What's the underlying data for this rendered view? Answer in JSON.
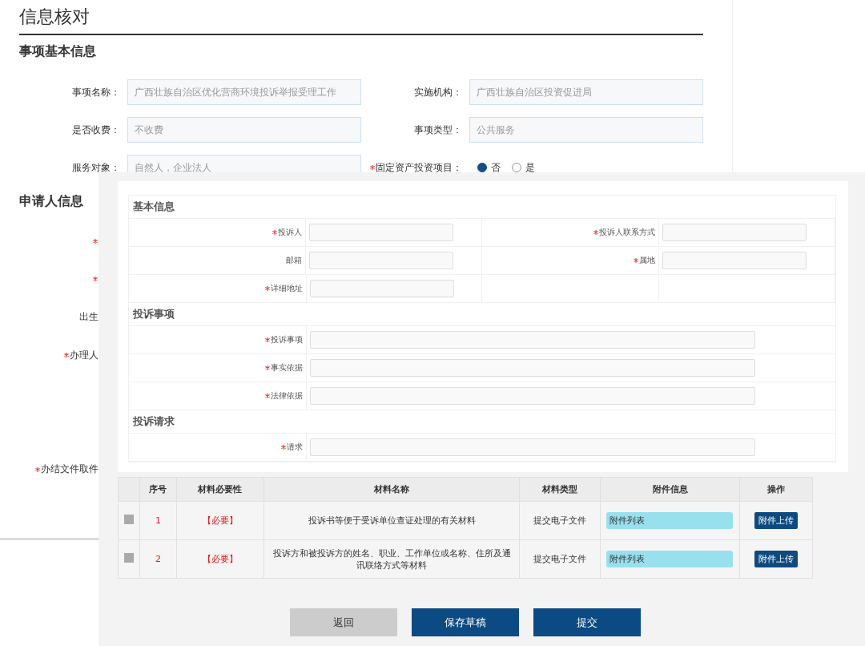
{
  "page_title": "信息核对",
  "item_section": {
    "heading": "事项基本信息",
    "fields": [
      {
        "kind": "input",
        "label": "事项名称：",
        "required": false,
        "value": "广西壮族自治区优化营商环境投诉举报受理工作"
      },
      {
        "kind": "input",
        "label": "实施机构：",
        "required": false,
        "value": "广西壮族自治区投资促进局"
      },
      {
        "kind": "input",
        "label": "是否收费：",
        "required": false,
        "value": "不收费"
      },
      {
        "kind": "input",
        "label": "事项类型：",
        "required": false,
        "value": "公共服务"
      },
      {
        "kind": "input",
        "label": "服务对象：",
        "required": false,
        "value": "自然人，企业法人"
      },
      {
        "kind": "radio",
        "label": "固定资产投资项目：",
        "required": true,
        "options": [
          {
            "label": "否",
            "selected": true
          },
          {
            "label": "是",
            "selected": false
          }
        ]
      }
    ]
  },
  "applicant_section": {
    "heading": "申请人信息",
    "rows": [
      {
        "kind": "label",
        "required": true
      },
      {
        "kind": "label",
        "required": true
      },
      {
        "kind": "label",
        "required": false,
        "label": "出生"
      },
      {
        "kind": "label",
        "required": true,
        "label": "办理人"
      },
      {
        "kind": "covered"
      },
      {
        "kind": "covered"
      },
      {
        "kind": "label",
        "required": true,
        "label": "办结文件取件"
      }
    ]
  },
  "complaint_form": {
    "sections": [
      {
        "kind": "grid",
        "heading": "基本信息",
        "fields": [
          {
            "label": "投诉人",
            "required": true
          },
          {
            "label": "投诉人联系方式",
            "required": true
          },
          {
            "label": "邮箱",
            "required": false
          },
          {
            "label": "属地",
            "required": true
          },
          {
            "label": "详细地址",
            "required": true
          }
        ]
      },
      {
        "kind": "wide",
        "heading": "投诉事项",
        "fields": [
          {
            "label": "投诉事项",
            "required": true
          },
          {
            "label": "事实依据",
            "required": true
          },
          {
            "label": "法律依据",
            "required": true
          }
        ]
      },
      {
        "kind": "wide",
        "heading": "投诉请求",
        "fields": [
          {
            "label": "请求",
            "required": true
          }
        ]
      }
    ]
  },
  "materials": {
    "columns": [
      "序号",
      "材料必要性",
      "材料名称",
      "材料类型",
      "附件信息",
      "操作"
    ],
    "rows": [
      {
        "checked": false,
        "index": "1",
        "necessity": "【必要】",
        "name": "投诉书等便于受诉单位查证处理的有关材料",
        "type": "提交电子文件",
        "attachment": "附件列表",
        "action": "附件上传"
      },
      {
        "checked": false,
        "index": "2",
        "necessity": "【必要】",
        "name": "投诉方和被投诉方的姓名、职业、工作单位或名称、住所及通讯联络方式等材料",
        "type": "提交电子文件",
        "attachment": "附件列表",
        "action": "附件上传"
      }
    ]
  },
  "buttons": [
    {
      "label": "返回",
      "kind": "secondary"
    },
    {
      "label": "保存草稿",
      "kind": "primary"
    },
    {
      "label": "提交",
      "kind": "primary"
    }
  ]
}
